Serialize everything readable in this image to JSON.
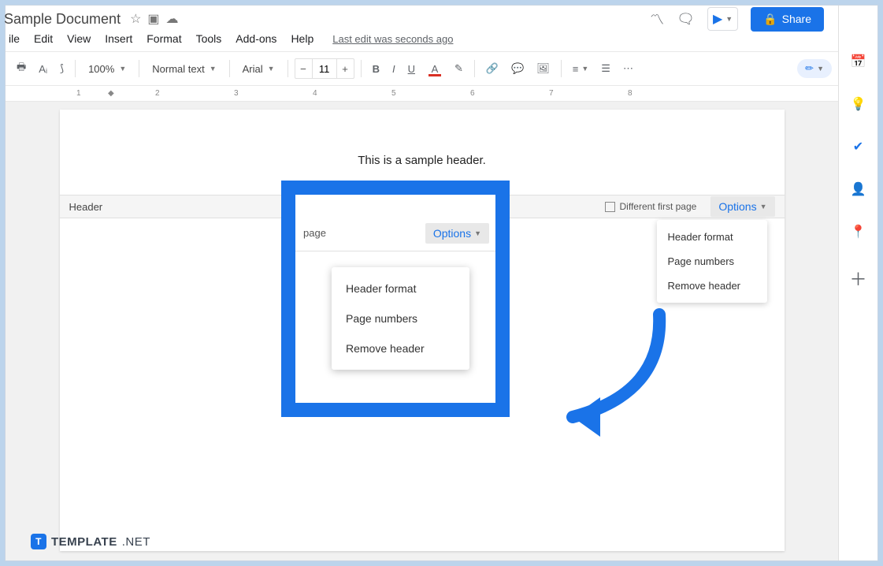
{
  "title": "Sample Document",
  "menus": {
    "file": "ile",
    "edit": "Edit",
    "view": "View",
    "insert": "Insert",
    "format": "Format",
    "tools": "Tools",
    "addons": "Add-ons",
    "help": "Help"
  },
  "lastEdit": "Last edit was seconds ago",
  "share": "Share",
  "toolbar": {
    "zoom": "100%",
    "style": "Normal text",
    "font": "Arial",
    "size": "11"
  },
  "header": {
    "title": "Header",
    "firstPage": "Different first page",
    "options": "Options"
  },
  "menuItems": {
    "format": "Header format",
    "numbers": "Page numbers",
    "remove": "Remove header"
  },
  "doc": {
    "headerText": "This is a sample header."
  },
  "callout": {
    "page": "page",
    "options": "Options",
    "format": "Header format",
    "numbers": "Page numbers",
    "remove": "Remove header"
  },
  "brand": {
    "name": "TEMPLATE",
    "suffix": ".NET"
  },
  "ruler": [
    "1",
    "2",
    "3",
    "4",
    "5",
    "6",
    "7",
    "8"
  ]
}
